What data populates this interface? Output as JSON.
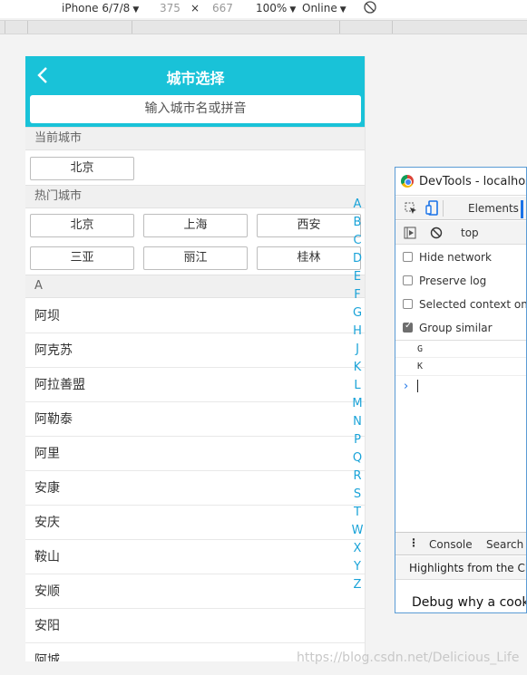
{
  "device_toolbar": {
    "device": "iPhone 6/7/8",
    "width": "375",
    "times": "×",
    "height": "667",
    "zoom": "100%",
    "network": "Online"
  },
  "app": {
    "title": "城市选择",
    "search_placeholder": "输入城市名或拼音",
    "current_label": "当前城市",
    "current_city": "北京",
    "hot_label": "热门城市",
    "hot_cities": [
      "北京",
      "上海",
      "西安",
      "三亚",
      "丽江",
      "桂林"
    ],
    "group_a_label": "A",
    "cities": [
      "阿坝",
      "阿克苏",
      "阿拉善盟",
      "阿勒泰",
      "阿里",
      "安康",
      "安庆",
      "鞍山",
      "安顺",
      "安阳",
      "阿城"
    ],
    "alphabet": [
      "A",
      "B",
      "C",
      "D",
      "E",
      "F",
      "G",
      "H",
      "J",
      "K",
      "L",
      "M",
      "N",
      "P",
      "Q",
      "R",
      "S",
      "T",
      "W",
      "X",
      "Y",
      "Z"
    ]
  },
  "devtools": {
    "window_title": "DevTools - localhost:",
    "tab_elements": "Elements",
    "context": "top",
    "options": [
      {
        "label": "Hide network",
        "checked": false
      },
      {
        "label": "Preserve log",
        "checked": false
      },
      {
        "label": "Selected context only",
        "checked": false
      },
      {
        "label": "Group similar",
        "checked": true
      }
    ],
    "log_entries": [
      "G",
      "K"
    ],
    "prompt_symbol": "›",
    "drawer_more": "⋮",
    "drawer_console": "Console",
    "drawer_search": "Search",
    "highlights": "Highlights from the Chro",
    "debug_text": "Debug why a cookie"
  },
  "watermark": "https://blog.csdn.net/Delicious_Life",
  "colors": {
    "header": "#19c2d8",
    "alphabet": "#1aa3d8",
    "accent_blue": "#1a73e8"
  }
}
